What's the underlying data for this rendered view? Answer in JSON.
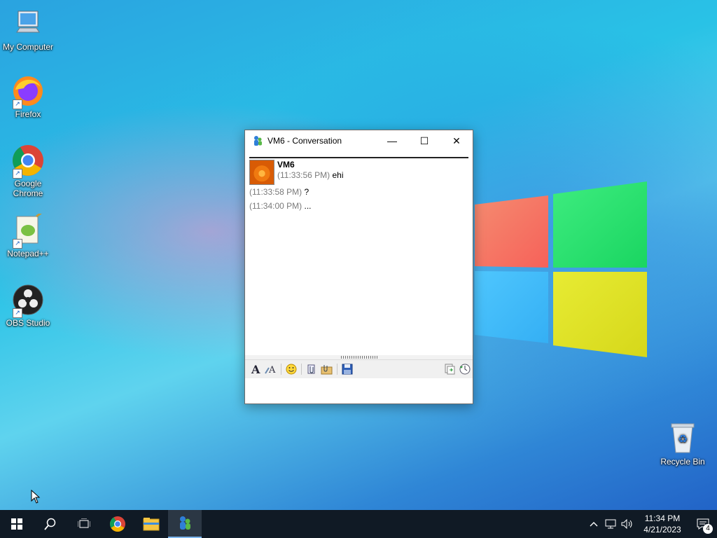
{
  "desktop": {
    "icons": [
      {
        "label": "My Computer"
      },
      {
        "label": "Firefox"
      },
      {
        "label": "Google Chrome"
      },
      {
        "label": "Notepad++"
      },
      {
        "label": "OBS Studio"
      },
      {
        "label": "Recycle Bin"
      }
    ]
  },
  "window": {
    "title": "VM6 - Conversation",
    "minimize_glyph": "—",
    "maximize_glyph": "☐",
    "close_glyph": "✕",
    "messages": [
      {
        "sender": "VM6",
        "time": "(11:33:56 PM)",
        "text": "ehi"
      },
      {
        "time": "(11:33:58 PM)",
        "text": "?"
      },
      {
        "time": "(11:34:00 PM)",
        "text": "..."
      }
    ]
  },
  "taskbar": {
    "clock_time": "11:34 PM",
    "clock_date": "4/21/2023",
    "notification_count": "4"
  },
  "colors": {
    "taskbar_bg": "#101a25",
    "accent": "#7db6ee"
  }
}
